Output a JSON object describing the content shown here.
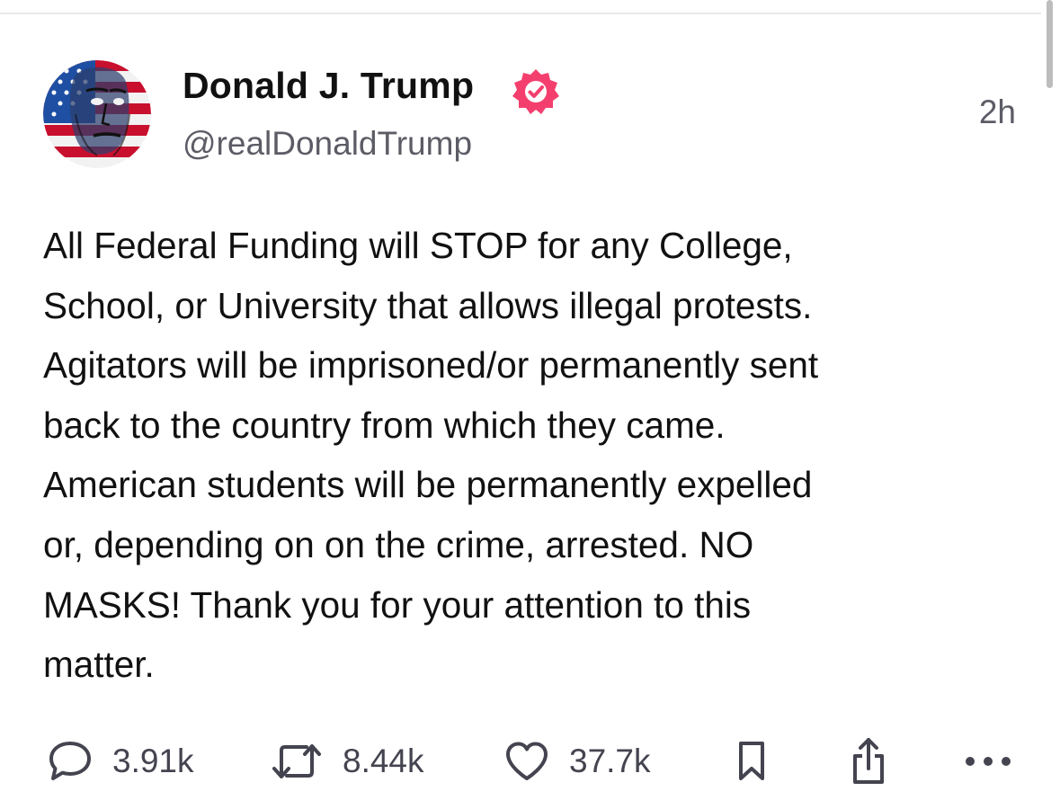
{
  "post": {
    "author": {
      "name": "Donald J. Trump",
      "handle": "@realDonaldTrump",
      "verified": true,
      "verified_color": "#f43f6e"
    },
    "timestamp": "2h",
    "body": "All Federal Funding will STOP for any College,\nSchool, or University that allows illegal protests.\nAgitators will be imprisoned/or permanently sent\nback to the country from which they came.\nAmerican students will be permanently expelled\nor, depending on on the crime, arrested. NO\nMASKS! Thank you for your attention to this\nmatter.",
    "actions": {
      "replies": "3.91k",
      "reposts": "8.44k",
      "likes": "37.7k",
      "icons": [
        "reply-icon",
        "repost-icon",
        "heart-icon",
        "bookmark-icon",
        "share-icon",
        "more-icon"
      ]
    }
  },
  "colors": {
    "text_primary": "#111111",
    "text_secondary": "#5c5c66",
    "icon": "#444450"
  }
}
